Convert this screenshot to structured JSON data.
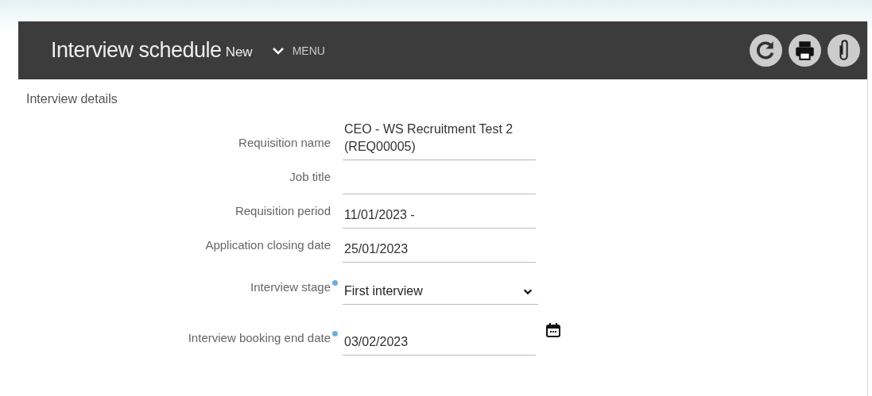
{
  "header": {
    "title": "Interview schedule",
    "badge": "New",
    "menu": "MENU",
    "actions": [
      {
        "kind": "refresh"
      },
      {
        "kind": "print"
      },
      {
        "kind": "attach"
      }
    ]
  },
  "section": {
    "title": "Interview details"
  },
  "fields": [
    {
      "kind": "text",
      "label": "Requisition name",
      "value": "CEO - WS Recruitment Test 2 (REQ00005)",
      "required": false
    },
    {
      "kind": "text",
      "label": "Job title",
      "required": false
    },
    {
      "kind": "text",
      "label": "Requisition period",
      "value": "11/01/2023 -",
      "required": false
    },
    {
      "kind": "text",
      "label": "Application closing date",
      "value": "25/01/2023",
      "required": false
    },
    {
      "kind": "select",
      "label": "Interview stage",
      "value": "First interview",
      "required": true
    },
    {
      "kind": "date",
      "label": "Interview booking end date",
      "value": "03/02/2023",
      "required": true
    }
  ]
}
